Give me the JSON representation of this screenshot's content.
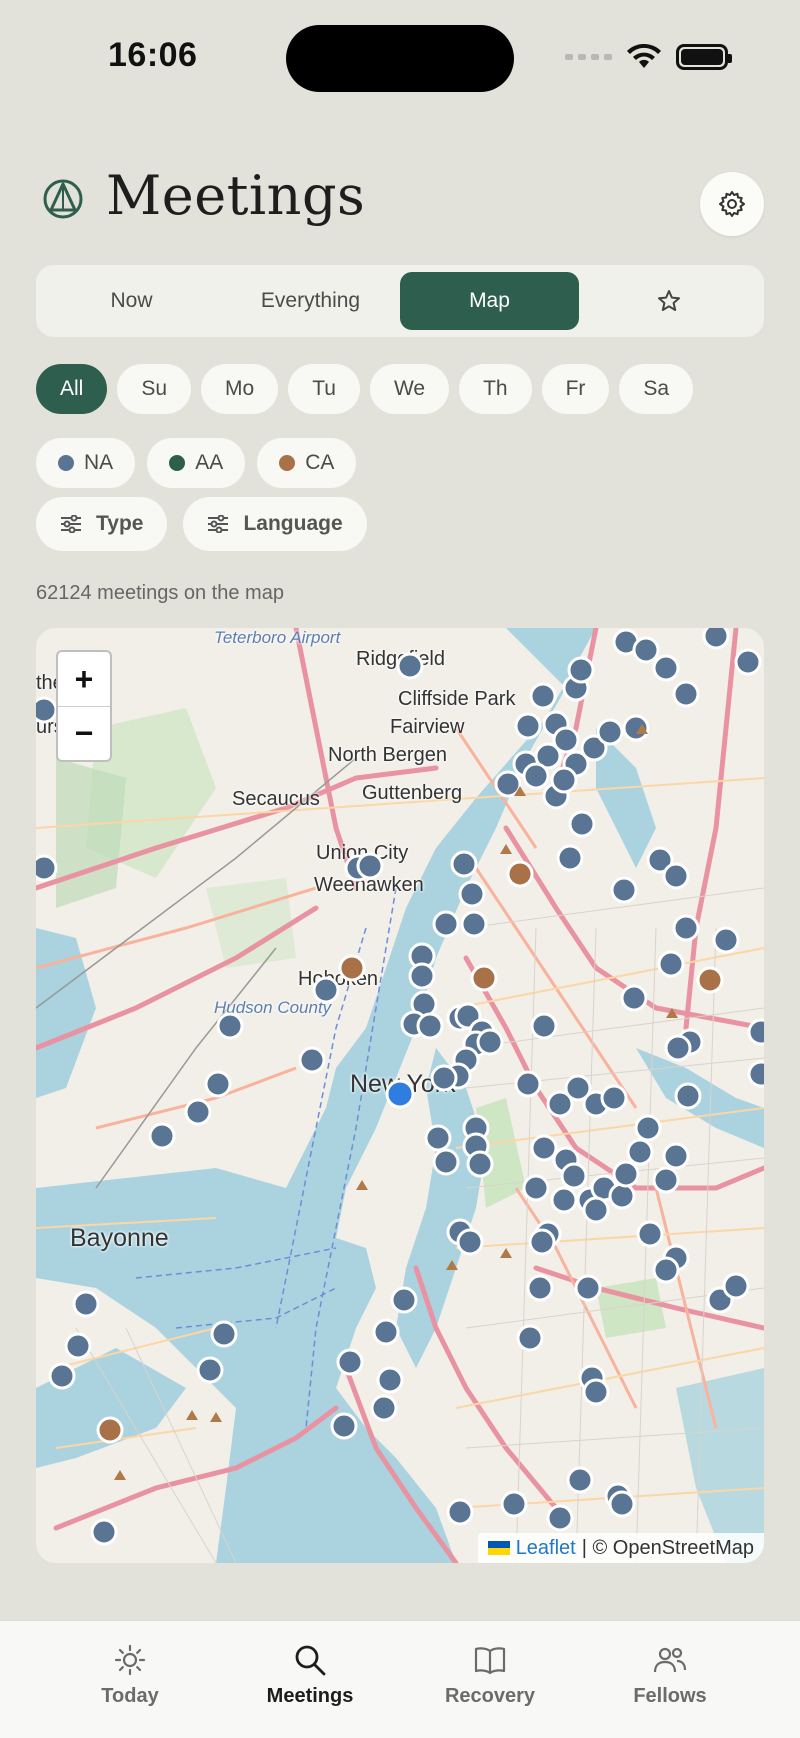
{
  "status_bar": {
    "time": "16:06"
  },
  "header": {
    "title": "Meetings",
    "logo_icon": "compass-triangle-icon",
    "settings_icon": "gear-icon"
  },
  "segments": [
    {
      "label": "Now",
      "active": false
    },
    {
      "label": "Everything",
      "active": false
    },
    {
      "label": "Map",
      "active": true
    },
    {
      "label": "",
      "icon": "star-icon",
      "active": false
    }
  ],
  "days": [
    "All",
    "Su",
    "Mo",
    "Tu",
    "We",
    "Th",
    "Fr",
    "Sa"
  ],
  "days_active": "All",
  "fellowships": [
    {
      "label": "NA",
      "color": "#5a7594"
    },
    {
      "label": "AA",
      "color": "#2e5e4e"
    },
    {
      "label": "CA",
      "color": "#a87148"
    }
  ],
  "filters": [
    {
      "label": "Type",
      "icon": "sliders-icon"
    },
    {
      "label": "Language",
      "icon": "sliders-icon"
    }
  ],
  "count_text": "62124 meetings on the map",
  "map": {
    "zoom_in": "+",
    "zoom_out": "−",
    "attribution_link": "Leaflet",
    "attribution_text": "| © OpenStreetMap",
    "labels": {
      "ridgefield": "Ridgefield",
      "cliffside": "Cliffside Park",
      "fairview": "Fairview",
      "north_bergen": "North Bergen",
      "guttenberg": "Guttenberg",
      "secaucus": "Secaucus",
      "union_city": "Union City",
      "weehawken": "Weehawken",
      "hoboken": "Hoboken",
      "new_york": "New York",
      "bayonne": "Bayonne",
      "rutherford": "therford",
      "lyndhurst": "urst",
      "teterboro": "Teterboro Airport",
      "hudson": "Hudson County"
    }
  },
  "tabbar": [
    {
      "label": "Today",
      "icon": "sun-icon",
      "active": false
    },
    {
      "label": "Meetings",
      "icon": "search-icon",
      "active": true
    },
    {
      "label": "Recovery",
      "icon": "book-icon",
      "active": false
    },
    {
      "label": "Fellows",
      "icon": "people-icon",
      "active": false
    }
  ]
}
